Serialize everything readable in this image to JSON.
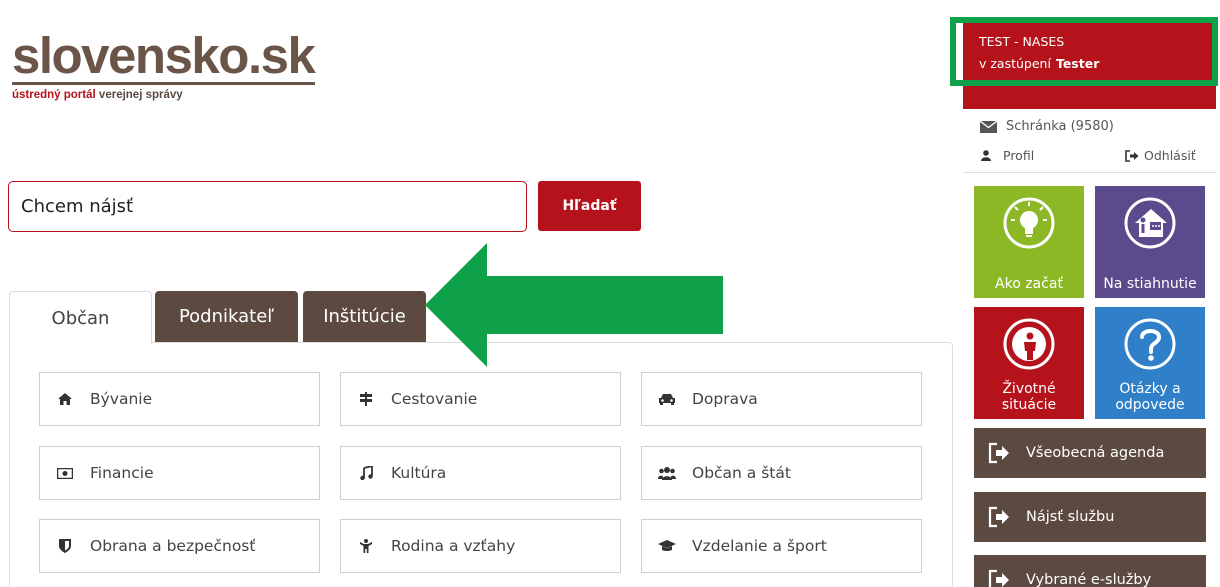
{
  "logo": {
    "wordmark": "slovensko.sk",
    "tag_a": "ústredný portál",
    "tag_b": "verejnej správy"
  },
  "search": {
    "value": "Chcem nájsť",
    "button": "Hľadať"
  },
  "tabs": [
    {
      "label": "Občan",
      "active": true
    },
    {
      "label": "Podnikateľ",
      "active": false
    },
    {
      "label": "Inštitúcie",
      "active": false
    }
  ],
  "categories": [
    {
      "label": "Bývanie",
      "icon": "home-icon"
    },
    {
      "label": "Cestovanie",
      "icon": "signpost-icon"
    },
    {
      "label": "Doprava",
      "icon": "car-icon"
    },
    {
      "label": "Financie",
      "icon": "money-icon"
    },
    {
      "label": "Kultúra",
      "icon": "music-icon"
    },
    {
      "label": "Občan a štát",
      "icon": "group-icon"
    },
    {
      "label": "Obrana a bezpečnosť",
      "icon": "shield-icon"
    },
    {
      "label": "Rodina a vzťahy",
      "icon": "child-icon"
    },
    {
      "label": "Vzdelanie a šport",
      "icon": "graduation-cap-icon"
    }
  ],
  "user": {
    "name": "TEST - NASES",
    "on_behalf_prefix": "v zastúpení",
    "on_behalf_name": "Tester"
  },
  "inbox": {
    "label": "Schránka",
    "count": "(9580)"
  },
  "profile": {
    "label": "Profil"
  },
  "logout": {
    "label": "Odhlásiť"
  },
  "tiles": [
    {
      "label": "Ako začať",
      "color": "#8db826",
      "icon": "lightbulb-icon"
    },
    {
      "label": "Na stiahnutie",
      "color": "#5b4a8c",
      "icon": "download-house-icon"
    },
    {
      "label": "Životné situácie",
      "label_lines": [
        "Životné",
        "situácie"
      ],
      "color": "#b5121b",
      "icon": "person-icon"
    },
    {
      "label": "Otázky a odpovede",
      "label_lines": [
        "Otázky a",
        "odpovede"
      ],
      "color": "#2f80c9",
      "icon": "question-icon"
    }
  ],
  "side_buttons": [
    {
      "label": "Všeobecná agenda"
    },
    {
      "label": "Nájsť službu"
    },
    {
      "label": "Vybrané e-služby"
    }
  ],
  "colors": {
    "brand_red": "#b5121b",
    "brand_brown": "#5c4a40",
    "highlight_green": "#0fa04a"
  }
}
